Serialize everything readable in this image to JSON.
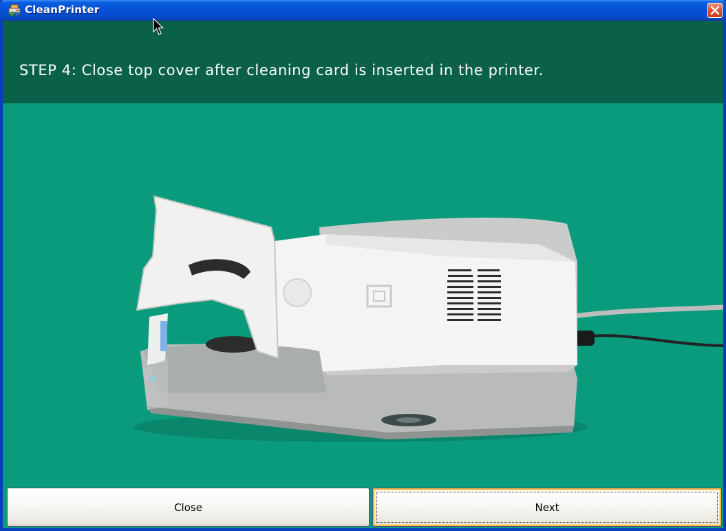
{
  "window": {
    "title": "CleanPrinter",
    "icon": "printer-app-icon"
  },
  "step": {
    "text": "STEP 4:  Close top cover after cleaning card is inserted in the printer."
  },
  "buttons": {
    "close_label": "Close",
    "next_label": "Next"
  },
  "colors": {
    "title_bar": "#0650d6",
    "header_bg": "#0a6048",
    "content_bg": "#0a9a7c",
    "close_button": "#e0522e"
  }
}
